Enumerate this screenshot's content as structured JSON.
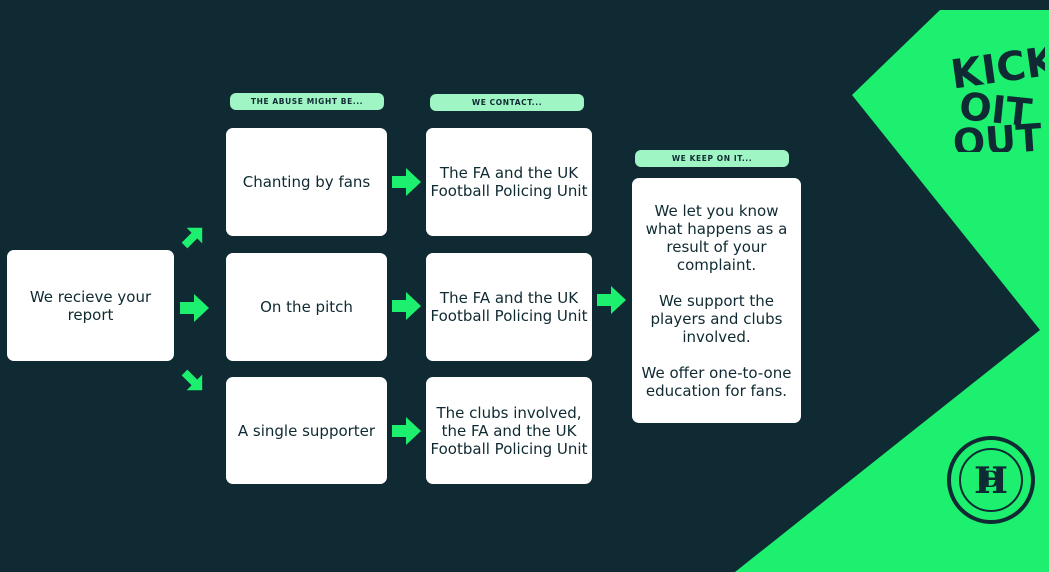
{
  "colors": {
    "background": "#0f2a32",
    "accent": "#1df06f",
    "pill": "#9ff5c4",
    "box": "#ffffff",
    "text": "#0f2a32"
  },
  "headers": {
    "abuse": "THE ABUSE MIGHT BE...",
    "contact": "WE CONTACT...",
    "keep": "WE KEEP ON IT..."
  },
  "start": {
    "label": "We recieve your report"
  },
  "abuse_types": [
    {
      "label": "Chanting by fans"
    },
    {
      "label": "On the pitch"
    },
    {
      "label": "A single supporter"
    }
  ],
  "contacts": [
    {
      "label": "The FA and the UK Football Policing Unit"
    },
    {
      "label": "The FA and the UK Football Policing Unit"
    },
    {
      "label": "The clubs involved, the FA and the UK Football Policing Unit"
    }
  ],
  "outcome": {
    "line1": "We let you know what happens as a result of your complaint.",
    "line2": "We support the players and clubs involved.",
    "line3": "We offer one-to-one education for fans."
  },
  "logos": {
    "kick_it_out": "KICK IT OUT",
    "club_badge": "DULWICH HAMLET F.C. FOUNDED 1893"
  }
}
